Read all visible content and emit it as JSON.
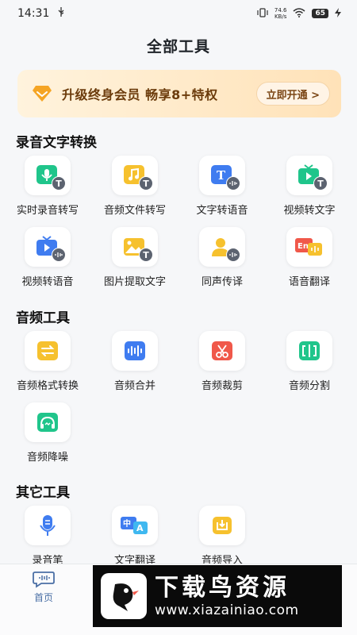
{
  "status_bar": {
    "time": "14:31",
    "net_speed_value": "74.6",
    "net_speed_unit": "KB/s",
    "battery": "65"
  },
  "page_title": "全部工具",
  "vip_banner": {
    "text": "升级终身会员  畅享8+特权",
    "button_label": "立即开通 >"
  },
  "sections": [
    {
      "title": "录音文字转换",
      "items": [
        {
          "label": "实时录音转写",
          "icon": "mic-to-text-icon"
        },
        {
          "label": "音频文件转写",
          "icon": "audio-file-to-text-icon"
        },
        {
          "label": "文字转语音",
          "icon": "text-to-speech-icon"
        },
        {
          "label": "视频转文字",
          "icon": "video-to-text-icon"
        },
        {
          "label": "视频转语音",
          "icon": "video-to-audio-icon"
        },
        {
          "label": "图片提取文字",
          "icon": "image-to-text-icon"
        },
        {
          "label": "同声传译",
          "icon": "simultaneous-interpretation-icon"
        },
        {
          "label": "语音翻译",
          "icon": "voice-translate-icon"
        }
      ]
    },
    {
      "title": "音频工具",
      "items": [
        {
          "label": "音频格式转换",
          "icon": "audio-format-convert-icon"
        },
        {
          "label": "音频合并",
          "icon": "audio-merge-icon"
        },
        {
          "label": "音频裁剪",
          "icon": "audio-cut-icon"
        },
        {
          "label": "音频分割",
          "icon": "audio-split-icon"
        },
        {
          "label": "音频降噪",
          "icon": "audio-denoise-icon"
        }
      ]
    },
    {
      "title": "其它工具",
      "items": [
        {
          "label": "录音笔",
          "icon": "voice-recorder-icon"
        },
        {
          "label": "文字翻译",
          "icon": "text-translate-icon"
        },
        {
          "label": "音频导入",
          "icon": "audio-import-icon"
        }
      ]
    }
  ],
  "tab_bar": {
    "home_label": "首页"
  },
  "watermark": {
    "title": "下载鸟资源",
    "url": "www.xiazainiao.com"
  },
  "colors": {
    "accent_green": "#20c58b",
    "accent_blue": "#3f7cf0",
    "accent_yellow": "#f6c12e",
    "accent_red": "#f0584a",
    "vip_text": "#6b3b0b"
  }
}
